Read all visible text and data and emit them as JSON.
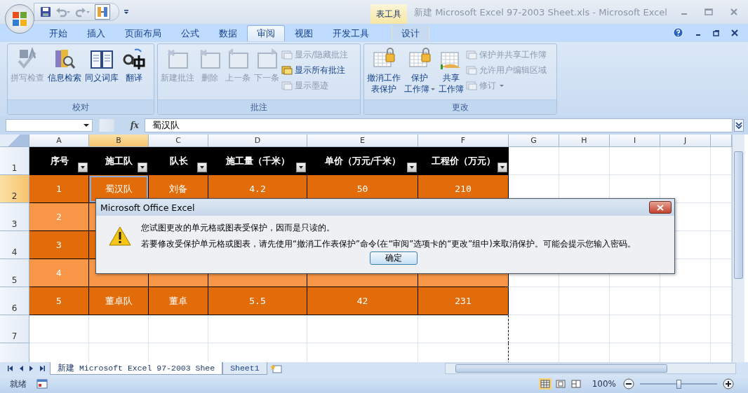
{
  "window": {
    "title": "新建 Microsoft Excel 97-2003 Sheet.xls - Microsoft Excel",
    "contextual_tab": "表工具"
  },
  "ribbon_tabs": [
    {
      "label": "开始",
      "selected": false,
      "contextual": false
    },
    {
      "label": "插入",
      "selected": false,
      "contextual": false
    },
    {
      "label": "页面布局",
      "selected": false,
      "contextual": false
    },
    {
      "label": "公式",
      "selected": false,
      "contextual": false
    },
    {
      "label": "数据",
      "selected": false,
      "contextual": false
    },
    {
      "label": "审阅",
      "selected": true,
      "contextual": false
    },
    {
      "label": "视图",
      "selected": false,
      "contextual": false
    },
    {
      "label": "开发工具",
      "selected": false,
      "contextual": false
    },
    {
      "label": "设计",
      "selected": false,
      "contextual": true
    }
  ],
  "ribbon_groups": [
    {
      "label": "校对",
      "items": [
        {
          "label": "拼写检查",
          "kind": "large",
          "disabled": true
        },
        {
          "label": "信息检索",
          "kind": "large",
          "disabled": false
        },
        {
          "label": "同义词库",
          "kind": "large",
          "disabled": false
        },
        {
          "label": "翻译",
          "kind": "large",
          "disabled": false
        }
      ]
    },
    {
      "label": "批注",
      "items": [
        {
          "label": "新建批注",
          "kind": "large",
          "disabled": true
        },
        {
          "label": "删除",
          "kind": "large",
          "disabled": true
        },
        {
          "label": "上一条",
          "kind": "large",
          "disabled": true
        },
        {
          "label": "下一条",
          "kind": "large",
          "disabled": true
        },
        {
          "label": "显示/隐藏批注",
          "kind": "small",
          "disabled": true
        },
        {
          "label": "显示所有批注",
          "kind": "small",
          "disabled": false
        },
        {
          "label": "显示墨迹",
          "kind": "small",
          "disabled": true
        }
      ]
    },
    {
      "label": "更改",
      "items": [
        {
          "lines": [
            "撤消工作",
            "表保护"
          ],
          "kind": "large",
          "disabled": false
        },
        {
          "lines": [
            "保护",
            "工作簿"
          ],
          "kind": "large",
          "disabled": false,
          "dropdown": true
        },
        {
          "lines": [
            "共享",
            "工作簿"
          ],
          "kind": "large",
          "disabled": false
        },
        {
          "label": "保护并共享工作簿",
          "kind": "small",
          "disabled": true
        },
        {
          "label": "允许用户编辑区域",
          "kind": "small",
          "disabled": true
        },
        {
          "label": "修订",
          "kind": "small",
          "disabled": true,
          "dropdown": true
        }
      ]
    }
  ],
  "formula_bar": {
    "function_label": "fx",
    "value": "蜀汉队"
  },
  "columns": [
    {
      "label": "A",
      "selected": false
    },
    {
      "label": "B",
      "selected": true
    },
    {
      "label": "C",
      "selected": false
    },
    {
      "label": "D",
      "selected": false
    },
    {
      "label": "E",
      "selected": false
    },
    {
      "label": "F",
      "selected": false
    },
    {
      "label": "G",
      "selected": false
    },
    {
      "label": "H",
      "selected": false
    },
    {
      "label": "I",
      "selected": false
    },
    {
      "label": "J",
      "selected": false
    }
  ],
  "table": {
    "headers": [
      "序号",
      "施工队",
      "队长",
      "施工量（千米）",
      "单价（万元/千米）",
      "工程价（万元）"
    ],
    "rows": [
      {
        "number": "2",
        "selected": true,
        "dark": true,
        "cells": [
          {
            "text": "1",
            "selected": false
          },
          {
            "text": "蜀汉队",
            "selected": true
          },
          {
            "text": "刘备",
            "selected": false
          },
          {
            "text": "4.2",
            "selected": false
          },
          {
            "text": "50",
            "selected": false
          },
          {
            "text": "210",
            "selected": false
          }
        ]
      },
      {
        "number": "3",
        "selected": false,
        "dark": false,
        "cells": [
          {
            "text": "2",
            "selected": false
          }
        ]
      },
      {
        "number": "4",
        "selected": false,
        "dark": true,
        "cells": [
          {
            "text": "3",
            "selected": false
          }
        ]
      },
      {
        "number": "5",
        "selected": false,
        "dark": false,
        "cells": [
          {
            "text": "4",
            "selected": false
          }
        ]
      },
      {
        "number": "6",
        "selected": false,
        "dark": true,
        "cells": [
          {
            "text": "5",
            "selected": false
          },
          {
            "text": "董卓队",
            "selected": false
          },
          {
            "text": "董卓",
            "selected": false
          },
          {
            "text": "5.5",
            "selected": false
          },
          {
            "text": "42",
            "selected": false
          },
          {
            "text": "231",
            "selected": false
          }
        ]
      }
    ]
  },
  "header_row_number": "1",
  "empty_rows": [
    "7"
  ],
  "sheet_tabs": [
    {
      "label": "新建 Microsoft Excel 97-2003 Shee",
      "selected": true
    },
    {
      "label": "Sheet1",
      "selected": false
    }
  ],
  "status_bar": {
    "status": "就绪",
    "zoom": "100%",
    "zoom_slider": {
      "level": 0.5
    }
  },
  "dialog": {
    "title": "Microsoft Office Excel",
    "messages": [
      "您试图更改的单元格或图表受保护，因而是只读的。",
      "若要修改受保护单元格或图表，请先使用“撤消工作表保护”命令(在“审阅”选项卡的“更改”组中)来取消保护。可能会提示您输入密码。"
    ],
    "button": "确定"
  }
}
